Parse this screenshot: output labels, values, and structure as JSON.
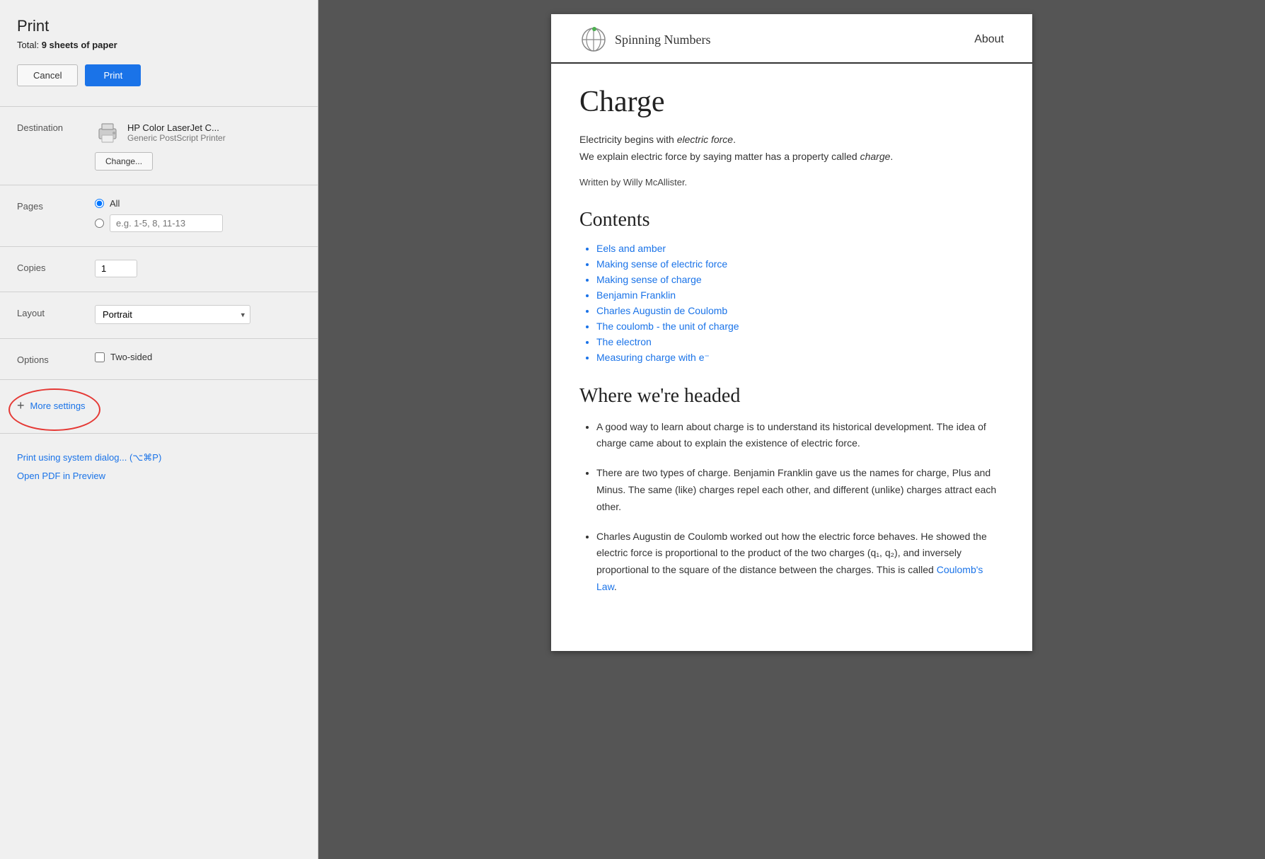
{
  "print": {
    "title": "Print",
    "total_label": "Total:",
    "total_value": "9 sheets of paper",
    "cancel_label": "Cancel",
    "print_label": "Print"
  },
  "destination": {
    "label": "Destination",
    "printer_name": "HP Color LaserJet C...",
    "printer_sub": "Generic PostScript Printer",
    "change_label": "Change..."
  },
  "pages": {
    "label": "Pages",
    "option_all": "All",
    "option_custom_placeholder": "e.g. 1-5, 8, 11-13"
  },
  "copies": {
    "label": "Copies",
    "value": "1"
  },
  "layout": {
    "label": "Layout",
    "value": "Portrait"
  },
  "options": {
    "label": "Options",
    "two_sided_label": "Two-sided"
  },
  "more_settings": {
    "plus": "+",
    "label": "More settings"
  },
  "bottom_links": {
    "system_dialog": "Print using system dialog... (⌥⌘P)",
    "pdf_preview": "Open PDF in Preview"
  },
  "preview": {
    "logo_text": "Spinning Numbers",
    "about_label": "About",
    "page_title": "Charge",
    "intro_line1_start": "Electricity begins with ",
    "intro_line1_italic": "electric force",
    "intro_line1_end": ".",
    "intro_line2_start": "We explain electric force by saying matter has a property called ",
    "intro_line2_italic": "charge",
    "intro_line2_end": ".",
    "author": "Written by Willy McAllister.",
    "contents_heading": "Contents",
    "contents_items": [
      "Eels and amber",
      "Making sense of electric force",
      "Making sense of charge",
      "Benjamin Franklin",
      "Charles Augustin de Coulomb",
      "The coulomb - the unit of charge",
      "The electron",
      "Measuring charge with e⁻"
    ],
    "where_heading": "Where we're headed",
    "bullets": [
      "A good way to learn about charge is to understand its historical development. The idea of charge came about to explain the existence of electric force.",
      "There are two types of charge. Benjamin Franklin gave us the names for charge, Plus and Minus. The same (like) charges repel each other, and different (unlike) charges attract each other.",
      "Charles Augustin de Coulomb worked out how the electric force behaves. He showed the electric force is proportional to the product of the two charges (q₁, q₂), and inversely proportional to the square of the distance between the charges. This is called Coulomb's Law."
    ],
    "coulombs_law_link": "Coulomb's Law"
  }
}
